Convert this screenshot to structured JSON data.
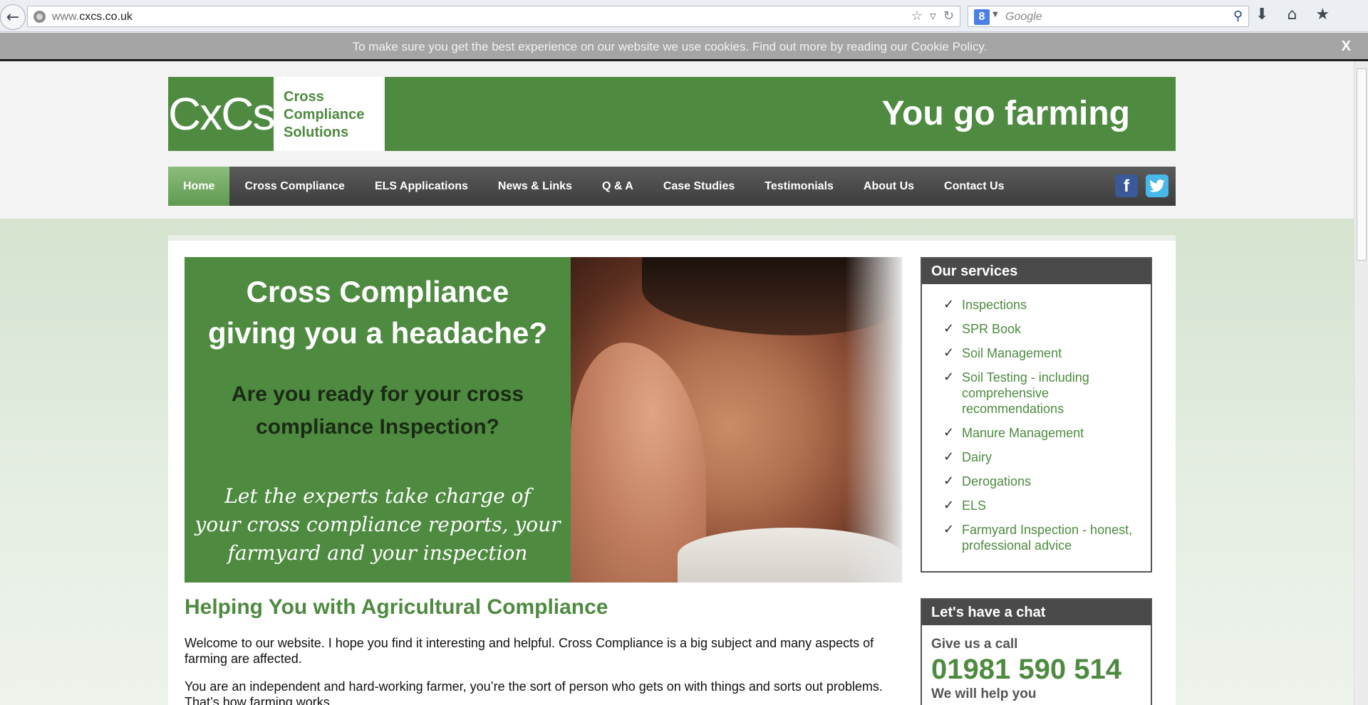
{
  "browser": {
    "url_prefix": "www.",
    "url_domain": "cxcs.co.uk",
    "search_placeholder": "Google",
    "search_badge": "8",
    "icons": [
      "back-icon",
      "globe-icon",
      "star-icon",
      "dropdown-icon",
      "reload-icon",
      "search-icon",
      "download-icon",
      "home-icon",
      "bookmarks-icon"
    ]
  },
  "cookie": {
    "text": "To make sure you get the best experience on our website we use cookies. Find out more by reading our Cookie Policy.",
    "close": "X"
  },
  "header": {
    "logo_mark": "CxCs",
    "logo_line1": "Cross",
    "logo_line2": "Compliance",
    "logo_line3": "Solutions",
    "tagline": "You go farming"
  },
  "nav": {
    "items": [
      {
        "label": "Home",
        "active": true
      },
      {
        "label": "Cross Compliance"
      },
      {
        "label": "ELS Applications"
      },
      {
        "label": "News & Links"
      },
      {
        "label": "Q & A"
      },
      {
        "label": "Case Studies"
      },
      {
        "label": "Testimonials"
      },
      {
        "label": "About Us"
      },
      {
        "label": "Contact Us"
      }
    ],
    "facebook_glyph": "f"
  },
  "hero": {
    "heading_line1": "Cross Compliance",
    "heading_line2": "giving you a headache?",
    "sub_line1": "Are you ready for your cross",
    "sub_line2": "compliance Inspection?",
    "italic_line1": "Let the experts take charge of",
    "italic_line2": "your cross compliance reports, your",
    "italic_line3": "farmyard and your inspection"
  },
  "intro": {
    "title": "Helping You with Agricultural Compliance",
    "p1": "Welcome to our website. I hope you find it interesting and helpful. Cross Compliance is a big subject and many aspects of farming are affected.",
    "p2": "You are an independent and hard-working farmer, you’re the sort of person who gets on with things and sorts out problems. That’s how farming works."
  },
  "services": {
    "title": "Our services",
    "check": "✓",
    "items": [
      "Inspections",
      "SPR Book",
      "Soil Management",
      "Soil Testing - including comprehensive recommendations",
      "Manure Management",
      "Dairy",
      "Derogations",
      "ELS",
      "Farmyard Inspection - honest, professional advice"
    ]
  },
  "chat": {
    "title": "Let's have a chat",
    "sub": "Give us a call",
    "phone": "01981 590 514",
    "help": "We will help you"
  },
  "colors": {
    "brand_green": "#4e8a40",
    "nav_dark": "#4a4a4a",
    "nav_active": "#6fa85f"
  }
}
